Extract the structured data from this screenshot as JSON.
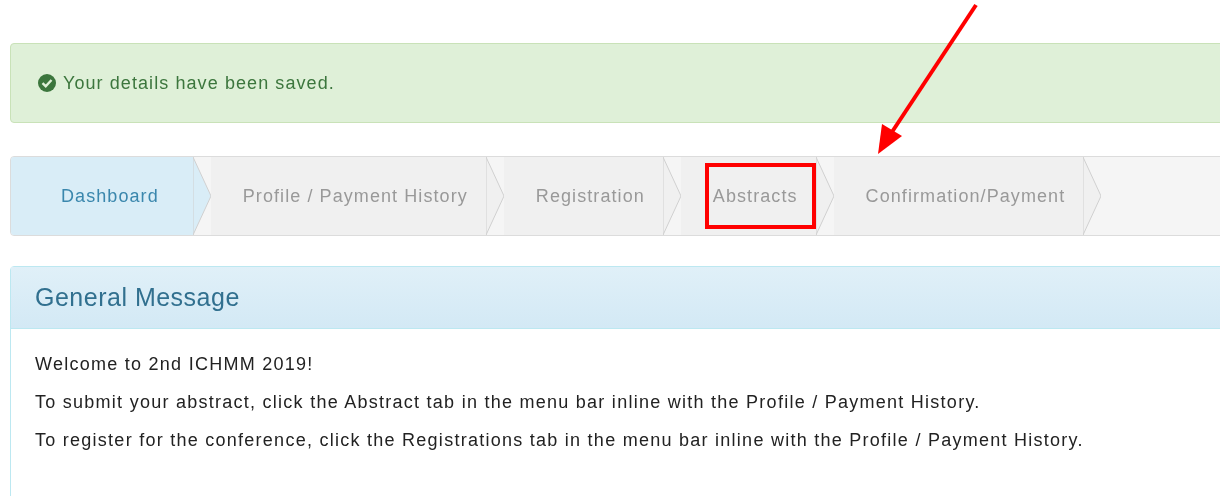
{
  "alert": {
    "text": "Your details have been saved."
  },
  "steps": [
    {
      "label": "Dashboard",
      "selected": true,
      "highlighted": false
    },
    {
      "label": "Profile / Payment History",
      "selected": false,
      "highlighted": false
    },
    {
      "label": "Registration",
      "selected": false,
      "highlighted": false
    },
    {
      "label": "Abstracts",
      "selected": false,
      "highlighted": true
    },
    {
      "label": "Confirmation/Payment",
      "selected": false,
      "highlighted": false
    }
  ],
  "panel": {
    "title": "General Message",
    "paragraphs": [
      "Welcome to 2nd ICHMM 2019!",
      "To submit your abstract, click the Abstract tab in the menu bar inline with the Profile / Payment History.",
      "To register for the conference, click the Registrations tab in the menu bar inline with the Profile / Payment History."
    ]
  }
}
